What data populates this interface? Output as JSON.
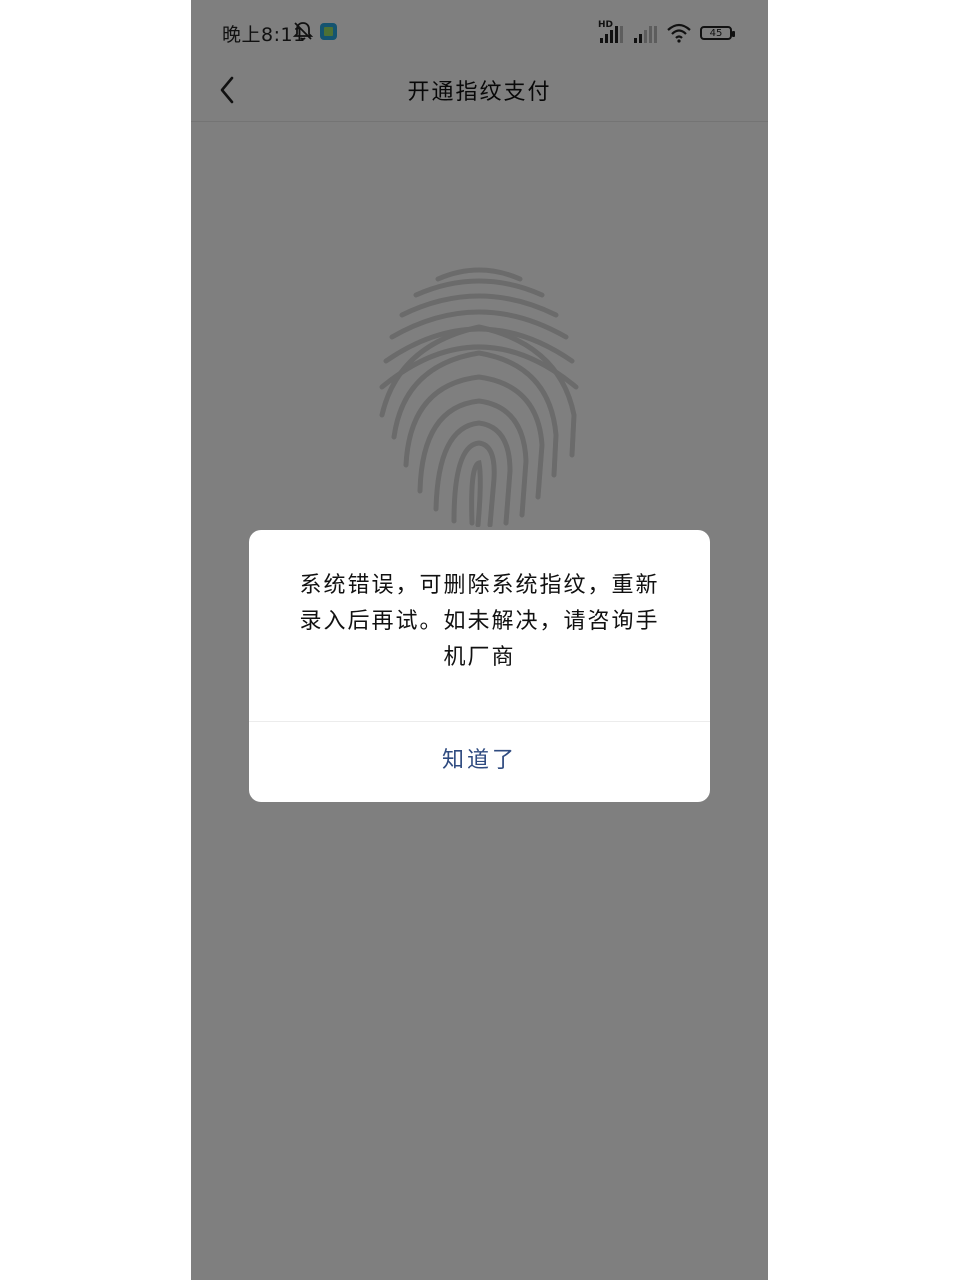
{
  "status_bar": {
    "time": "晚上8:11",
    "hd_label": "HD",
    "battery": "45",
    "icons": [
      "bell-muted-icon",
      "app-notification-icon",
      "signal-icon",
      "signal-icon",
      "wifi-icon",
      "battery-icon"
    ]
  },
  "nav": {
    "back_icon": "chevron-left-icon",
    "title": "开通指纹支付"
  },
  "main": {
    "illustration": "fingerprint-icon"
  },
  "dialog": {
    "message": "系统错误，可删除系统指纹，重新录入后再试。如未解决，请咨询手机厂商",
    "button_label": "知道了"
  },
  "colors": {
    "overlay": "rgba(0,0,0,0.5)",
    "dialog_button": "#2f4b80",
    "fingerprint": "#d9d9d9"
  }
}
